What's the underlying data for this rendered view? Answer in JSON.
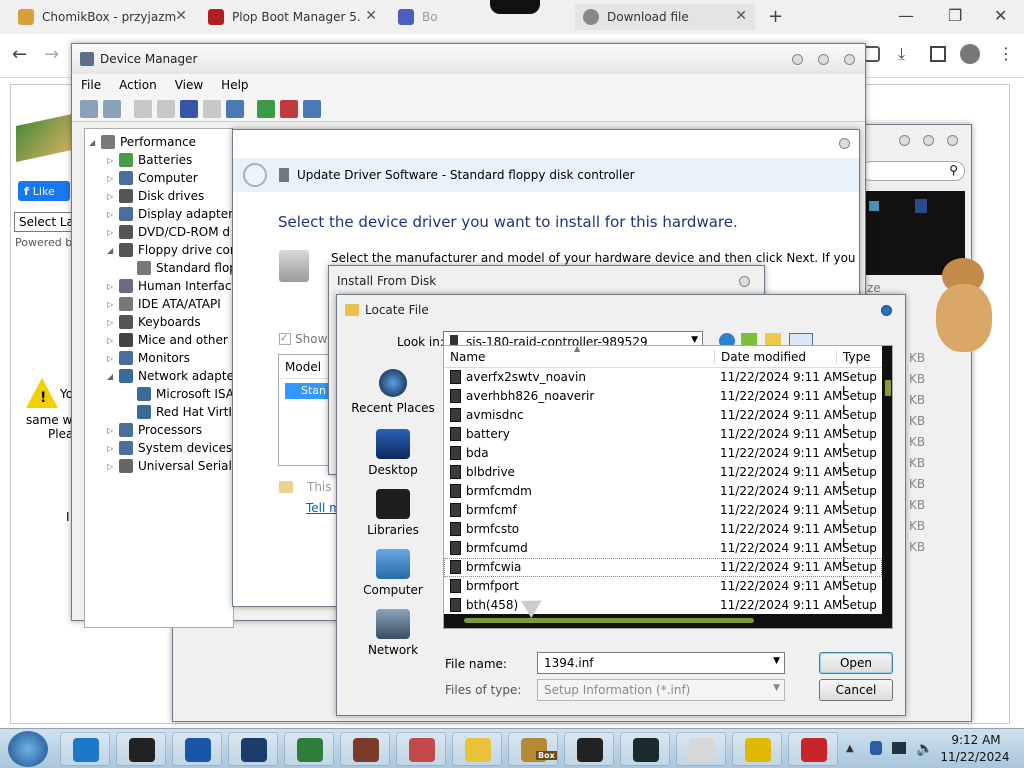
{
  "browser": {
    "tabs": [
      {
        "label": "ChomikBox - przyjazm",
        "color": "#d5a13b"
      },
      {
        "label": "Plop Boot Manager 5.",
        "color": "#b01e1e"
      },
      {
        "label": "Bo",
        "color": "#4a5fbf"
      },
      {
        "label": "Download file",
        "color": "#888888"
      }
    ],
    "new_tab": "+",
    "window_controls": [
      "—",
      "❐",
      "✕"
    ],
    "nav_back": "←",
    "nav_forward": "→"
  },
  "webpage": {
    "like_label": "Like",
    "select_label": "Select La",
    "powered_by": "Powered by",
    "warning_line1": "Yo",
    "warning_line2": "same wi",
    "warning_line3": "Plea",
    "kb_labels": [
      "KB",
      "KB",
      "KB",
      "KB",
      "KB",
      "KB",
      "KB",
      "KB",
      "KB",
      "KB"
    ],
    "ze_label": "ze",
    "left_char": "I"
  },
  "device_manager": {
    "title": "Device Manager",
    "menu": [
      "File",
      "Action",
      "View",
      "Help"
    ],
    "tree": [
      {
        "label": "Performance",
        "depth": 0,
        "expanded": true
      },
      {
        "label": "Batteries",
        "depth": 1
      },
      {
        "label": "Computer",
        "depth": 1
      },
      {
        "label": "Disk drives",
        "depth": 1
      },
      {
        "label": "Display adapters",
        "depth": 1
      },
      {
        "label": "DVD/CD-ROM d",
        "depth": 1
      },
      {
        "label": "Floppy drive cor",
        "depth": 1,
        "expanded": true
      },
      {
        "label": "Standard flop",
        "depth": 2
      },
      {
        "label": "Human Interfac",
        "depth": 1
      },
      {
        "label": "IDE ATA/ATAPI",
        "depth": 1
      },
      {
        "label": "Keyboards",
        "depth": 1
      },
      {
        "label": "Mice and other p",
        "depth": 1
      },
      {
        "label": "Monitors",
        "depth": 1
      },
      {
        "label": "Network adapte",
        "depth": 1,
        "expanded": true
      },
      {
        "label": "Microsoft ISA",
        "depth": 2
      },
      {
        "label": "Red Hat VirtI",
        "depth": 2
      },
      {
        "label": "Processors",
        "depth": 1
      },
      {
        "label": "System devices",
        "depth": 1
      },
      {
        "label": "Universal Serial E",
        "depth": 1
      }
    ]
  },
  "update_driver": {
    "title": "Update Driver Software - Standard floppy disk controller",
    "heading": "Select the device driver you want to install for this hardware.",
    "instruction": "Select the manufacturer and model of your hardware device and then click Next. If you have a",
    "show_label": "Show",
    "model_header": "Model",
    "model_item": "Stan",
    "this_label": "This",
    "tell_link": "Tell m"
  },
  "install_from_disk": {
    "title": "Install From Disk"
  },
  "locate_file": {
    "title": "Locate File",
    "look_in_label": "Look in:",
    "look_in_value": "sis-180-raid-controller-989529",
    "places": [
      "Recent Places",
      "Desktop",
      "Libraries",
      "Computer",
      "Network"
    ],
    "columns": {
      "name": "Name",
      "date": "Date modified",
      "type": "Type"
    },
    "files": [
      {
        "name": "averfx2swtv_noavin",
        "date": "11/22/2024 9:11 AM",
        "type": "Setup I"
      },
      {
        "name": "averhbh826_noaverir",
        "date": "11/22/2024 9:11 AM",
        "type": "Setup I"
      },
      {
        "name": "avmisdnc",
        "date": "11/22/2024 9:11 AM",
        "type": "Setup I"
      },
      {
        "name": "battery",
        "date": "11/22/2024 9:11 AM",
        "type": "Setup I"
      },
      {
        "name": "bda",
        "date": "11/22/2024 9:11 AM",
        "type": "Setup I"
      },
      {
        "name": "blbdrive",
        "date": "11/22/2024 9:11 AM",
        "type": "Setup I"
      },
      {
        "name": "brmfcmdm",
        "date": "11/22/2024 9:11 AM",
        "type": "Setup I"
      },
      {
        "name": "brmfcmf",
        "date": "11/22/2024 9:11 AM",
        "type": "Setup I"
      },
      {
        "name": "brmfcsto",
        "date": "11/22/2024 9:11 AM",
        "type": "Setup I"
      },
      {
        "name": "brmfcumd",
        "date": "11/22/2024 9:11 AM",
        "type": "Setup I"
      },
      {
        "name": "brmfcwia",
        "date": "11/22/2024 9:11 AM",
        "type": "Setup I"
      },
      {
        "name": "brmfport",
        "date": "11/22/2024 9:11 AM",
        "type": "Setup I"
      },
      {
        "name": "bth(458)",
        "date": "11/22/2024 9:11 AM",
        "type": "Setup I"
      }
    ],
    "file_name_label": "File name:",
    "file_name_value": "1394.inf",
    "file_type_label": "Files of type:",
    "file_type_value": "Setup Information (*.inf)",
    "open_label": "Open",
    "cancel_label": "Cancel"
  },
  "taskbar": {
    "time": "9:12 AM",
    "date": "11/22/2024",
    "box_label": "Box",
    "app_colors": [
      "#1e78c8",
      "#222222",
      "#1a56a8",
      "#1c3c6e",
      "#2e7d3a",
      "#7b3b2a",
      "#c24a4a",
      "#e9c23c",
      "#b68a34",
      "#222222",
      "#1b2a2a",
      "#d8d8d8",
      "#e0b800",
      "#c8252a"
    ]
  }
}
